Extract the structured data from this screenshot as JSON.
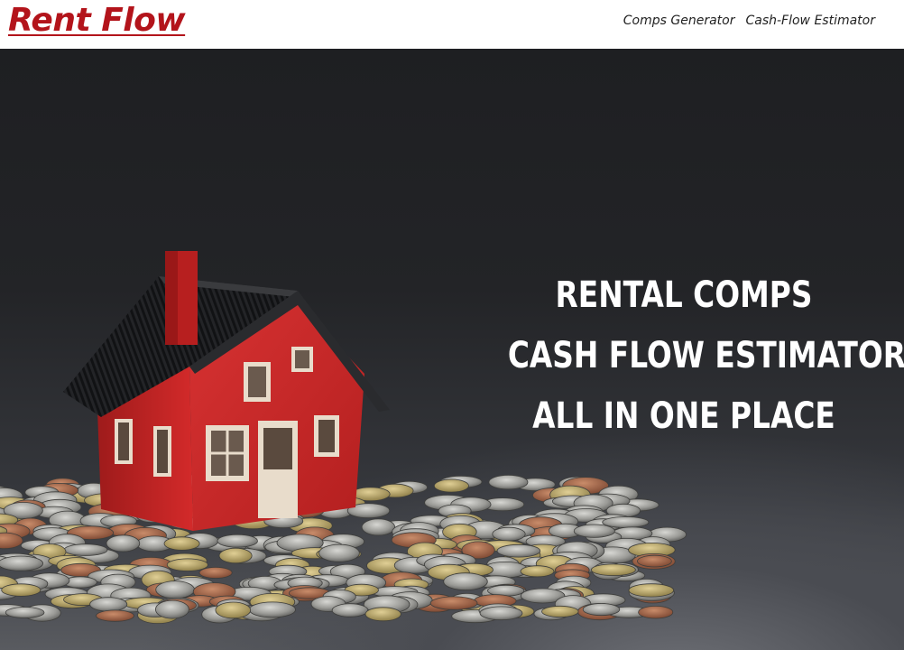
{
  "brand": {
    "name": "Rent Flow",
    "color": "#b3141b"
  },
  "nav": {
    "links": [
      {
        "label": "Comps Generator"
      },
      {
        "label": "Cash-Flow Estimator"
      }
    ]
  },
  "hero": {
    "lines": [
      "RENTAL COMPS",
      "CASH FLOW ESTIMATOR",
      "ALL IN ONE PLACE"
    ],
    "image": {
      "icon": "house-on-coins-photo",
      "house_color": "#c62828",
      "roof_color": "#1f2022",
      "trim_color": "#e8dccb"
    }
  }
}
